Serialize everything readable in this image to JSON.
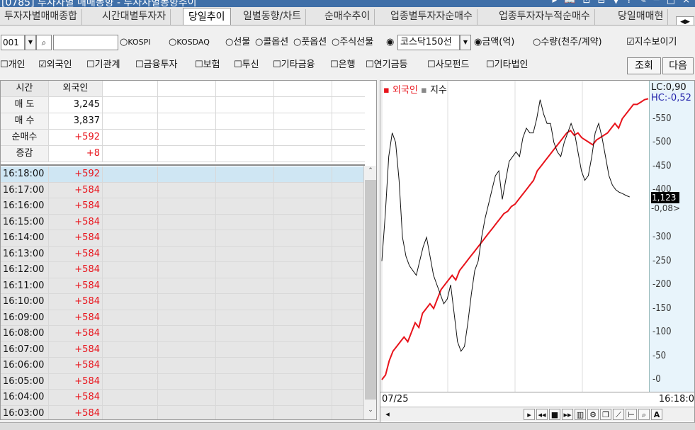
{
  "window": {
    "title": "[0785] 투자자별 매매동향 - 투자자별동향추이",
    "controls": "▸ 📖 ⊡ ⊟ ▼ ? ✎ ─ □ ×"
  },
  "tabs": [
    "투자자별매매종합",
    "시간대별투자자",
    "당일추이",
    "일별동향/차트",
    "순매수추이",
    "업종별투자자순매수",
    "업종투자자누적순매수",
    "당일매매현"
  ],
  "active_tab": "당일추이",
  "toolbar": {
    "code": "001",
    "dropdown": "▼",
    "search": "🔍",
    "radios": [
      "KOSPI",
      "KOSDAQ",
      "선물",
      "콜옵션",
      "풋옵션",
      "주식선물"
    ],
    "selected_market": "코스닥150선",
    "unit_radios": [
      "금액(억)",
      "수량(천주/계약)"
    ],
    "selected_unit": "금액(억)",
    "show_index_label": "지수보이기",
    "show_index_checked": true
  },
  "filters": {
    "items": [
      {
        "label": "개인",
        "checked": false
      },
      {
        "label": "외국인",
        "checked": true
      },
      {
        "label": "기관계",
        "checked": false
      },
      {
        "label": "금융투자",
        "checked": false
      },
      {
        "label": "보험",
        "checked": false
      },
      {
        "label": "투신",
        "checked": false
      },
      {
        "label": "기타금융",
        "checked": false
      },
      {
        "label": "은행",
        "checked": false
      },
      {
        "label": "연기금등",
        "checked": false
      },
      {
        "label": "사모펀드",
        "checked": false
      },
      {
        "label": "기타법인",
        "checked": false
      }
    ],
    "query_label": "조회",
    "next_label": "다음"
  },
  "grid": {
    "headers": [
      "시간",
      "외국인"
    ],
    "summary": [
      {
        "label": "매 도",
        "value": "3,245",
        "red": false
      },
      {
        "label": "매 수",
        "value": "3,837",
        "red": false
      },
      {
        "label": "순매수",
        "value": "+592",
        "red": true
      },
      {
        "label": "증감",
        "value": "+8",
        "red": true
      }
    ],
    "rows": [
      {
        "time": "16:18:00",
        "value": "+592"
      },
      {
        "time": "16:17:00",
        "value": "+584"
      },
      {
        "time": "16:16:00",
        "value": "+584"
      },
      {
        "time": "16:15:00",
        "value": "+584"
      },
      {
        "time": "16:14:00",
        "value": "+584"
      },
      {
        "time": "16:13:00",
        "value": "+584"
      },
      {
        "time": "16:12:00",
        "value": "+584"
      },
      {
        "time": "16:11:00",
        "value": "+584"
      },
      {
        "time": "16:10:00",
        "value": "+584"
      },
      {
        "time": "16:09:00",
        "value": "+584"
      },
      {
        "time": "16:08:00",
        "value": "+584"
      },
      {
        "time": "16:07:00",
        "value": "+584"
      },
      {
        "time": "16:06:00",
        "value": "+584"
      },
      {
        "time": "16:05:00",
        "value": "+584"
      },
      {
        "time": "16:04:00",
        "value": "+584"
      },
      {
        "time": "16:03:00",
        "value": "+584"
      }
    ]
  },
  "chart": {
    "legend_foreign": "외국인",
    "legend_index": "지수",
    "lc": "LC:0,90",
    "hc": "HC:-0,52",
    "current_value": "1,123",
    "current_change": "-0,08>",
    "date_label": "07/25",
    "time_label": "16:18:0",
    "y_ticks": [
      "550",
      "500",
      "450",
      "400",
      "300",
      "250",
      "200",
      "150",
      "100",
      "50",
      "0"
    ]
  },
  "chart_data": {
    "type": "line",
    "xlabel": "",
    "ylabel": "",
    "ylim": [
      0,
      600
    ],
    "series": [
      {
        "name": "외국인",
        "color": "#e8141c",
        "values": [
          0,
          10,
          40,
          60,
          70,
          80,
          90,
          80,
          100,
          120,
          110,
          140,
          150,
          160,
          150,
          170,
          190,
          200,
          210,
          220,
          210,
          230,
          240,
          250,
          260,
          270,
          280,
          290,
          300,
          310,
          320,
          330,
          340,
          350,
          355,
          365,
          370,
          380,
          390,
          400,
          410,
          420,
          440,
          450,
          460,
          470,
          480,
          490,
          500,
          510,
          520,
          525,
          515,
          520,
          510,
          505,
          500,
          495,
          505,
          510,
          515,
          520,
          530,
          540,
          530,
          550,
          560,
          570,
          580,
          580,
          585,
          590,
          592
        ]
      },
      {
        "name": "지수",
        "color": "#111111",
        "values": [
          250,
          350,
          470,
          520,
          500,
          420,
          300,
          260,
          240,
          230,
          220,
          250,
          280,
          300,
          260,
          220,
          200,
          180,
          160,
          170,
          200,
          140,
          80,
          60,
          70,
          120,
          180,
          230,
          250,
          300,
          340,
          370,
          400,
          430,
          440,
          380,
          420,
          460,
          470,
          480,
          470,
          510,
          530,
          520,
          520,
          550,
          590,
          560,
          540,
          540,
          500,
          480,
          470,
          500,
          520,
          540,
          520,
          480,
          440,
          420,
          430,
          470,
          520,
          540,
          510,
          470,
          430,
          410,
          400,
          395,
          392,
          388,
          385
        ]
      }
    ]
  }
}
